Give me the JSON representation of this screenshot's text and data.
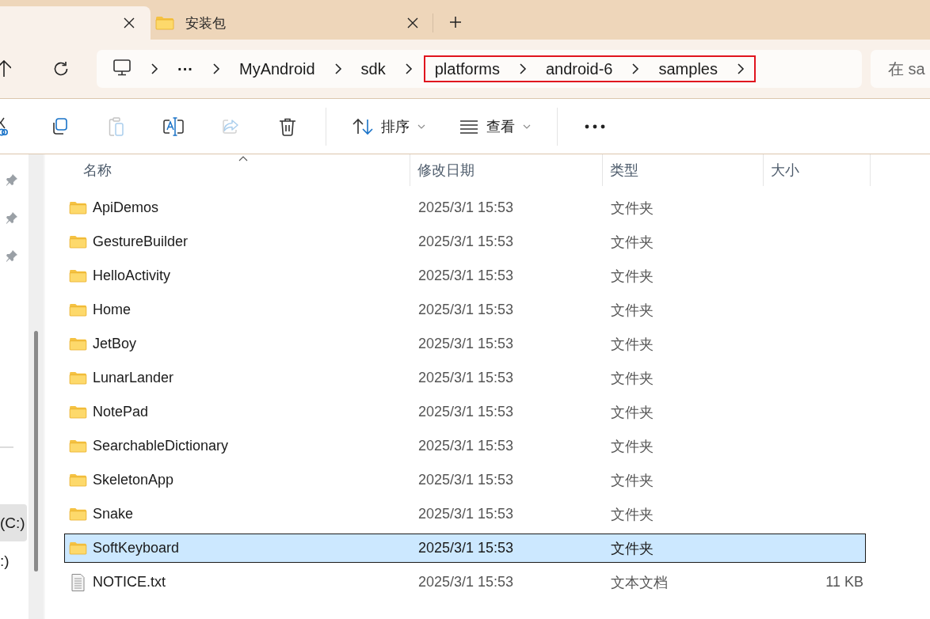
{
  "tabs": [
    {
      "selected": true
    },
    {
      "label": "安装包",
      "selected": false
    }
  ],
  "address_bar": {
    "crumbs": [
      {
        "kind": "computer",
        "highlighted": false
      },
      {
        "kind": "more",
        "label": "···",
        "highlighted": false
      },
      {
        "kind": "folder",
        "label": "MyAndroid",
        "highlighted": false
      },
      {
        "kind": "folder",
        "label": "sdk",
        "highlighted": false
      },
      {
        "kind": "folder",
        "label": "platforms",
        "highlighted": true
      },
      {
        "kind": "folder",
        "label": "android-6",
        "highlighted": true
      },
      {
        "kind": "folder",
        "label": "samples",
        "highlighted": true
      }
    ]
  },
  "search": {
    "placeholder": "在 sa"
  },
  "toolbar": [
    {
      "kind": "cut",
      "disabled": false
    },
    {
      "kind": "copy",
      "disabled": false
    },
    {
      "kind": "paste",
      "disabled": true
    },
    {
      "kind": "rename",
      "disabled": false
    },
    {
      "kind": "share",
      "disabled": true
    },
    {
      "kind": "delete",
      "disabled": false
    },
    {
      "kind": "separator"
    },
    {
      "kind": "sort",
      "label": "排序"
    },
    {
      "kind": "view",
      "label": "查看"
    },
    {
      "kind": "separator"
    },
    {
      "kind": "more"
    }
  ],
  "sidebar": {
    "drives": [
      {
        "label": "(C:)",
        "selected": true
      },
      {
        "label": ":)",
        "selected": false
      }
    ]
  },
  "columns": [
    "名称",
    "修改日期",
    "类型",
    "大小"
  ],
  "rows": [
    {
      "kind": "folder",
      "name": "ApiDemos",
      "modified": "2025/3/1 15:53",
      "type": "文件夹",
      "selected": false
    },
    {
      "kind": "folder",
      "name": "GestureBuilder",
      "modified": "2025/3/1 15:53",
      "type": "文件夹",
      "selected": false
    },
    {
      "kind": "folder",
      "name": "HelloActivity",
      "modified": "2025/3/1 15:53",
      "type": "文件夹",
      "selected": false
    },
    {
      "kind": "folder",
      "name": "Home",
      "modified": "2025/3/1 15:53",
      "type": "文件夹",
      "selected": false
    },
    {
      "kind": "folder",
      "name": "JetBoy",
      "modified": "2025/3/1 15:53",
      "type": "文件夹",
      "selected": false
    },
    {
      "kind": "folder",
      "name": "LunarLander",
      "modified": "2025/3/1 15:53",
      "type": "文件夹",
      "selected": false
    },
    {
      "kind": "folder",
      "name": "NotePad",
      "modified": "2025/3/1 15:53",
      "type": "文件夹",
      "selected": false
    },
    {
      "kind": "folder",
      "name": "SearchableDictionary",
      "modified": "2025/3/1 15:53",
      "type": "文件夹",
      "selected": false
    },
    {
      "kind": "folder",
      "name": "SkeletonApp",
      "modified": "2025/3/1 15:53",
      "type": "文件夹",
      "selected": false
    },
    {
      "kind": "folder",
      "name": "Snake",
      "modified": "2025/3/1 15:53",
      "type": "文件夹",
      "selected": false
    },
    {
      "kind": "folder",
      "name": "SoftKeyboard",
      "modified": "2025/3/1 15:53",
      "type": "文件夹",
      "selected": true
    },
    {
      "kind": "file",
      "name": "NOTICE.txt",
      "modified": "2025/3/1 15:53",
      "type": "文本文档",
      "size": "11 KB",
      "selected": false
    }
  ]
}
